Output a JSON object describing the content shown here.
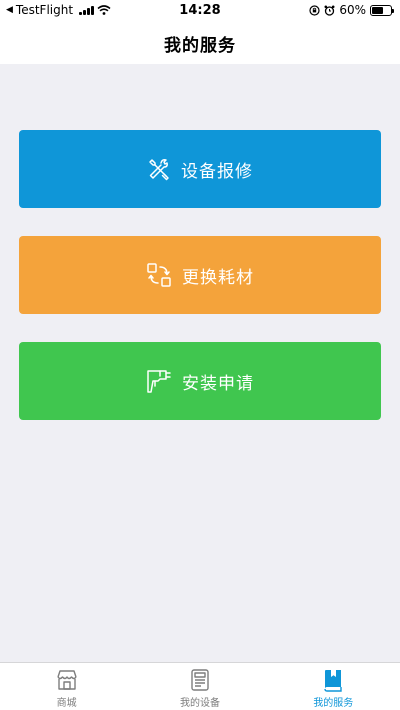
{
  "status_bar": {
    "carrier": "TestFlight",
    "time": "14:28",
    "battery": "60%",
    "battery_level": 0.6
  },
  "nav": {
    "title": "我的服务"
  },
  "actions": [
    {
      "label": "设备报修",
      "icon": "tools-icon",
      "color": "#0f96d8"
    },
    {
      "label": "更换耗材",
      "icon": "replace-icon",
      "color": "#f4a33b"
    },
    {
      "label": "安装申请",
      "icon": "drill-icon",
      "color": "#40c64f"
    }
  ],
  "tabs": [
    {
      "label": "商城",
      "icon": "store-icon",
      "active": false
    },
    {
      "label": "我的设备",
      "icon": "device-icon",
      "active": false
    },
    {
      "label": "我的服务",
      "icon": "book-icon",
      "active": true
    }
  ],
  "colors": {
    "accent": "#0f96d8",
    "background": "#efeff4"
  }
}
